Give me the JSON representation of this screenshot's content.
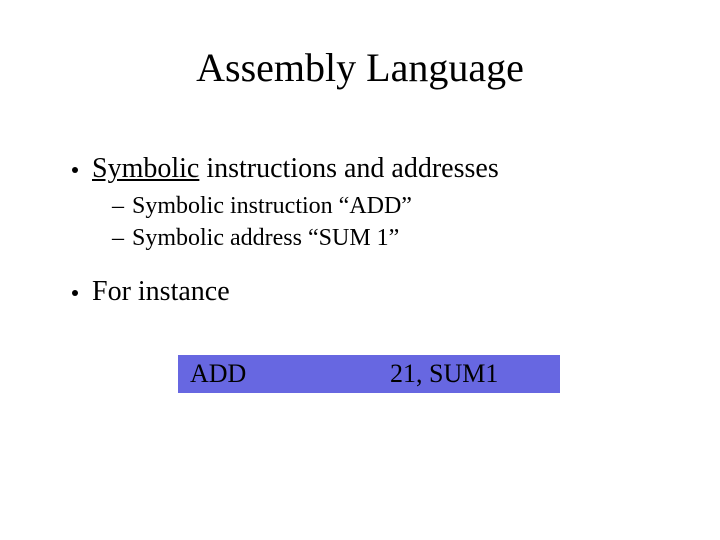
{
  "title": "Assembly Language",
  "bullets": {
    "b1": {
      "underlined": "Symbolic",
      "rest": " instructions and addresses"
    },
    "b1a": "Symbolic instruction “ADD”",
    "b1b": "Symbolic address “SUM 1”",
    "b2": "For instance"
  },
  "code": {
    "op": "ADD",
    "args": "21, SUM1"
  }
}
